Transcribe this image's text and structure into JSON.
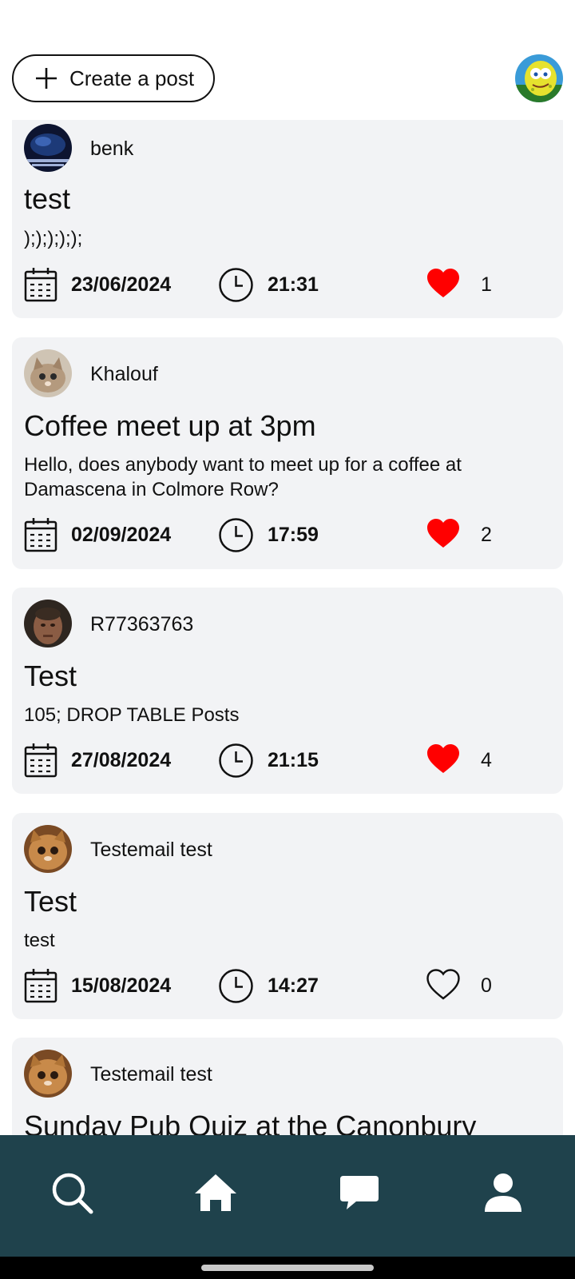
{
  "header": {
    "create_post_label": "Create a post"
  },
  "posts": [
    {
      "author": "benk",
      "title": "test",
      "body": ");););););",
      "date": "23/06/2024",
      "time": "21:31",
      "likes": "1",
      "liked": true
    },
    {
      "author": "Khalouf",
      "title": "Coffee meet up at 3pm",
      "body": "Hello, does anybody want to meet up for a coffee at Damascena in Colmore Row?",
      "date": "02/09/2024",
      "time": "17:59",
      "likes": "2",
      "liked": true
    },
    {
      "author": "R77363763",
      "title": "Test",
      "body": "105; DROP TABLE Posts",
      "date": "27/08/2024",
      "time": "21:15",
      "likes": "4",
      "liked": true
    },
    {
      "author": "Testemail test",
      "title": "Test",
      "body": "test",
      "date": "15/08/2024",
      "time": "14:27",
      "likes": "0",
      "liked": false
    },
    {
      "author": "Testemail test",
      "title": "Sunday Pub Quiz at the Canonbury"
    }
  ],
  "bottom_nav": {
    "items": [
      "search-icon",
      "home-icon",
      "chat-icon",
      "profile-icon"
    ]
  },
  "colors": {
    "nav_background": "#1f424c",
    "card_background": "#f2f3f5",
    "liked_heart": "#ff0000"
  }
}
